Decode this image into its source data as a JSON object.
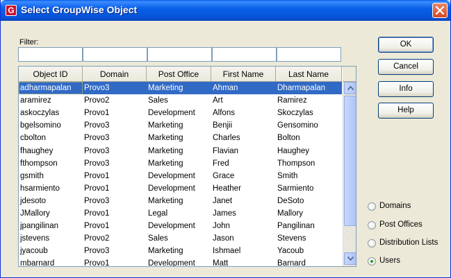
{
  "window": {
    "title": "Select GroupWise Object",
    "icon_letter": "G",
    "accent_color": "#0a5ee6",
    "close_color": "#d34a24"
  },
  "filter": {
    "label": "Filter:",
    "values": [
      "",
      "",
      "",
      "",
      ""
    ]
  },
  "table": {
    "headers": [
      "Object ID",
      "Domain",
      "Post Office",
      "First Name",
      "Last Name"
    ],
    "selected_row": 0,
    "rows": [
      [
        "adharmapalan",
        "Provo3",
        "Marketing",
        "Ahman",
        "Dharmapalan"
      ],
      [
        "aramirez",
        "Provo2",
        "Sales",
        "Art",
        "Ramirez"
      ],
      [
        "askoczylas",
        "Provo1",
        "Development",
        "Alfons",
        "Skoczylas"
      ],
      [
        "bgelsomino",
        "Provo3",
        "Marketing",
        "Benjii",
        "Gensomino"
      ],
      [
        "cbolton",
        "Provo3",
        "Marketing",
        "Charles",
        "Bolton"
      ],
      [
        "fhaughey",
        "Provo3",
        "Marketing",
        "Flavian",
        "Haughey"
      ],
      [
        "fthompson",
        "Provo3",
        "Marketing",
        "Fred",
        "Thompson"
      ],
      [
        "gsmith",
        "Provo1",
        "Development",
        "Grace",
        "Smith"
      ],
      [
        "hsarmiento",
        "Provo1",
        "Development",
        "Heather",
        "Sarmiento"
      ],
      [
        "jdesoto",
        "Provo3",
        "Marketing",
        "Janet",
        "DeSoto"
      ],
      [
        "JMallory",
        "Provo1",
        "Legal",
        "James",
        "Mallory"
      ],
      [
        "jpangilinan",
        "Provo1",
        "Development",
        "John",
        "Pangilinan"
      ],
      [
        "jstevens",
        "Provo2",
        "Sales",
        "Jason",
        "Stevens"
      ],
      [
        "jyacoub",
        "Provo3",
        "Marketing",
        "Ishmael",
        "Yacoub"
      ],
      [
        "mbarnard",
        "Provo1",
        "Development",
        "Matt",
        "Barnard"
      ]
    ]
  },
  "buttons": {
    "ok": "OK",
    "cancel": "Cancel",
    "info": "Info",
    "help": "Help"
  },
  "object_types": {
    "options": [
      "Domains",
      "Post Offices",
      "Distribution Lists",
      "Users"
    ],
    "selected": "Users"
  },
  "icons": {
    "app": "groupwise-icon",
    "close": "close-icon",
    "scroll_up": "scroll-up-arrow-icon",
    "scroll_down": "scroll-down-arrow-icon"
  }
}
